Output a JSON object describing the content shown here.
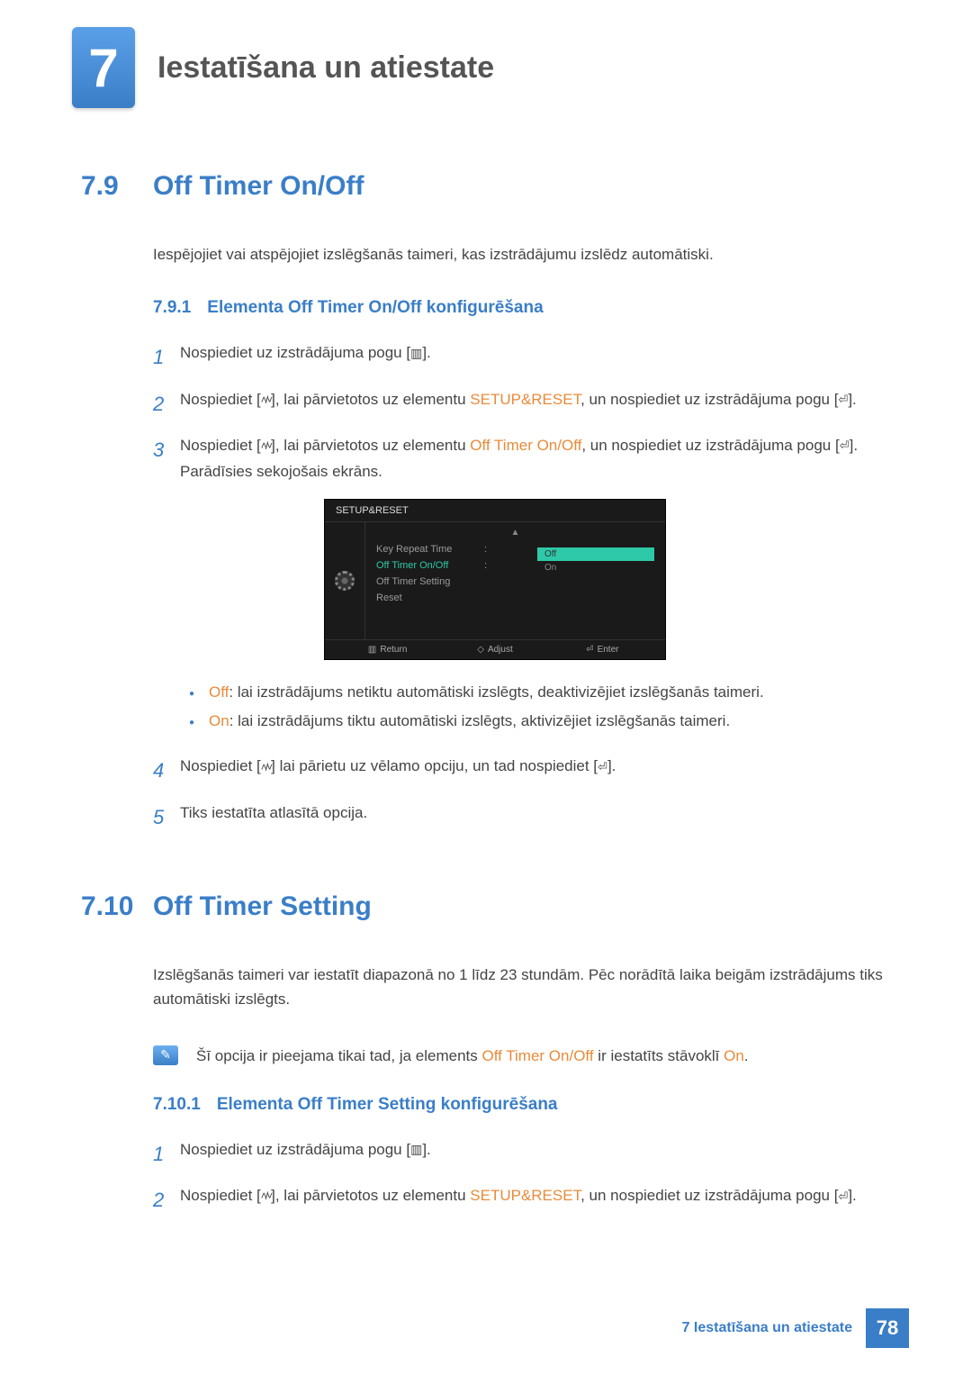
{
  "chapter": {
    "number": "7",
    "title": "Iestatīšana un atiestate"
  },
  "section1": {
    "num": "7.9",
    "title": "Off Timer On/Off",
    "intro": "Iespējojiet vai atspējojiet izslēgšanās taimeri, kas izstrādājumu izslēdz automātiski.",
    "sub": {
      "num": "7.9.1",
      "title": "Elementa Off Timer On/Off konfigurēšana"
    },
    "steps": {
      "s1": "Nospiediet uz izstrādājuma pogu [",
      "s1b": "].",
      "s2a": "Nospiediet [",
      "s2b": "], lai pārvietotos uz elementu ",
      "s2c": "SETUP&RESET",
      "s2d": ", un nospiediet uz izstrādājuma pogu [",
      "s2e": "].",
      "s3a": "Nospiediet [",
      "s3b": "], lai pārvietotos uz elementu ",
      "s3c": "Off Timer On/Off",
      "s3d": ", un nospiediet uz izstrādājuma pogu [",
      "s3e": "]. Parādīsies sekojošais ekrāns.",
      "s4a": "Nospiediet [",
      "s4b": "] lai pārietu uz vēlamo opciju, un tad nospiediet [",
      "s4c": "].",
      "s5": "Tiks iestatīta atlasītā opcija."
    },
    "bullets": {
      "b1a": "Off",
      "b1b": ": lai izstrādājums netiktu automātiski izslēgts, deaktivizējiet izslēgšanās taimeri.",
      "b2a": "On",
      "b2b": ": lai izstrādājums tiktu automātiski izslēgts, aktivizējiet izslēgšanās taimeri."
    }
  },
  "osd": {
    "header": "SETUP&RESET",
    "items": {
      "i1": "Key Repeat Time",
      "i2": "Off Timer On/Off",
      "i3": "Off Timer Setting",
      "i4": "Reset"
    },
    "options": {
      "o1": "Off",
      "o2": "On"
    },
    "footer": {
      "f1": "Return",
      "f2": "Adjust",
      "f3": "Enter"
    }
  },
  "section2": {
    "num": "7.10",
    "title": "Off Timer Setting",
    "intro": "Izslēgšanās taimeri var iestatīt diapazonā no 1 līdz 23 stundām. Pēc norādītā laika beigām izstrādājums tiks automātiski izslēgts.",
    "note_a": "Šī opcija ir pieejama tikai tad, ja elements ",
    "note_b": "Off Timer On/Off",
    "note_c": " ir iestatīts stāvoklī ",
    "note_d": "On",
    "note_e": ".",
    "sub": {
      "num": "7.10.1",
      "title": "Elementa Off Timer Setting konfigurēšana"
    },
    "steps": {
      "s1": "Nospiediet uz izstrādājuma pogu [",
      "s1b": "].",
      "s2a": "Nospiediet [",
      "s2b": "], lai pārvietotos uz elementu ",
      "s2c": "SETUP&RESET",
      "s2d": ", un nospiediet uz izstrādājuma pogu [",
      "s2e": "]."
    }
  },
  "footer": {
    "text": "7 Iestatīšana un atiestate",
    "page": "78"
  },
  "nums": {
    "n1": "1",
    "n2": "2",
    "n3": "3",
    "n4": "4",
    "n5": "5"
  }
}
